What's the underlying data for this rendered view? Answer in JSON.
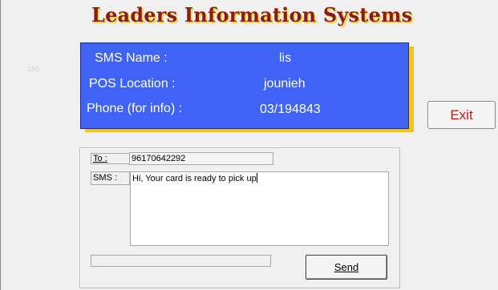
{
  "header": {
    "title": "Leaders Information Systems"
  },
  "background_number": "180",
  "info": {
    "sms_name_label": "SMS Name :",
    "sms_name_value": "lis",
    "pos_location_label": "POS Location :",
    "pos_location_value": "jounieh",
    "phone_label": "Phone (for info) :",
    "phone_value": "03/194843"
  },
  "buttons": {
    "exit": "Exit",
    "send": "Send"
  },
  "form": {
    "to_label": "To :",
    "to_value": "96170642292",
    "sms_label": "SMS :",
    "sms_value": "Hi, Your card is ready to pick up"
  },
  "progress": {
    "value": 0
  },
  "colors": {
    "title": "#8b1c1c",
    "title_shadow": "#f1d64b",
    "panel_bg": "#3f63f4",
    "panel_shadow": "#f1c51b",
    "exit_text": "#c8151b"
  },
  "icons": {
    "text_caret": "text-caret-icon"
  }
}
